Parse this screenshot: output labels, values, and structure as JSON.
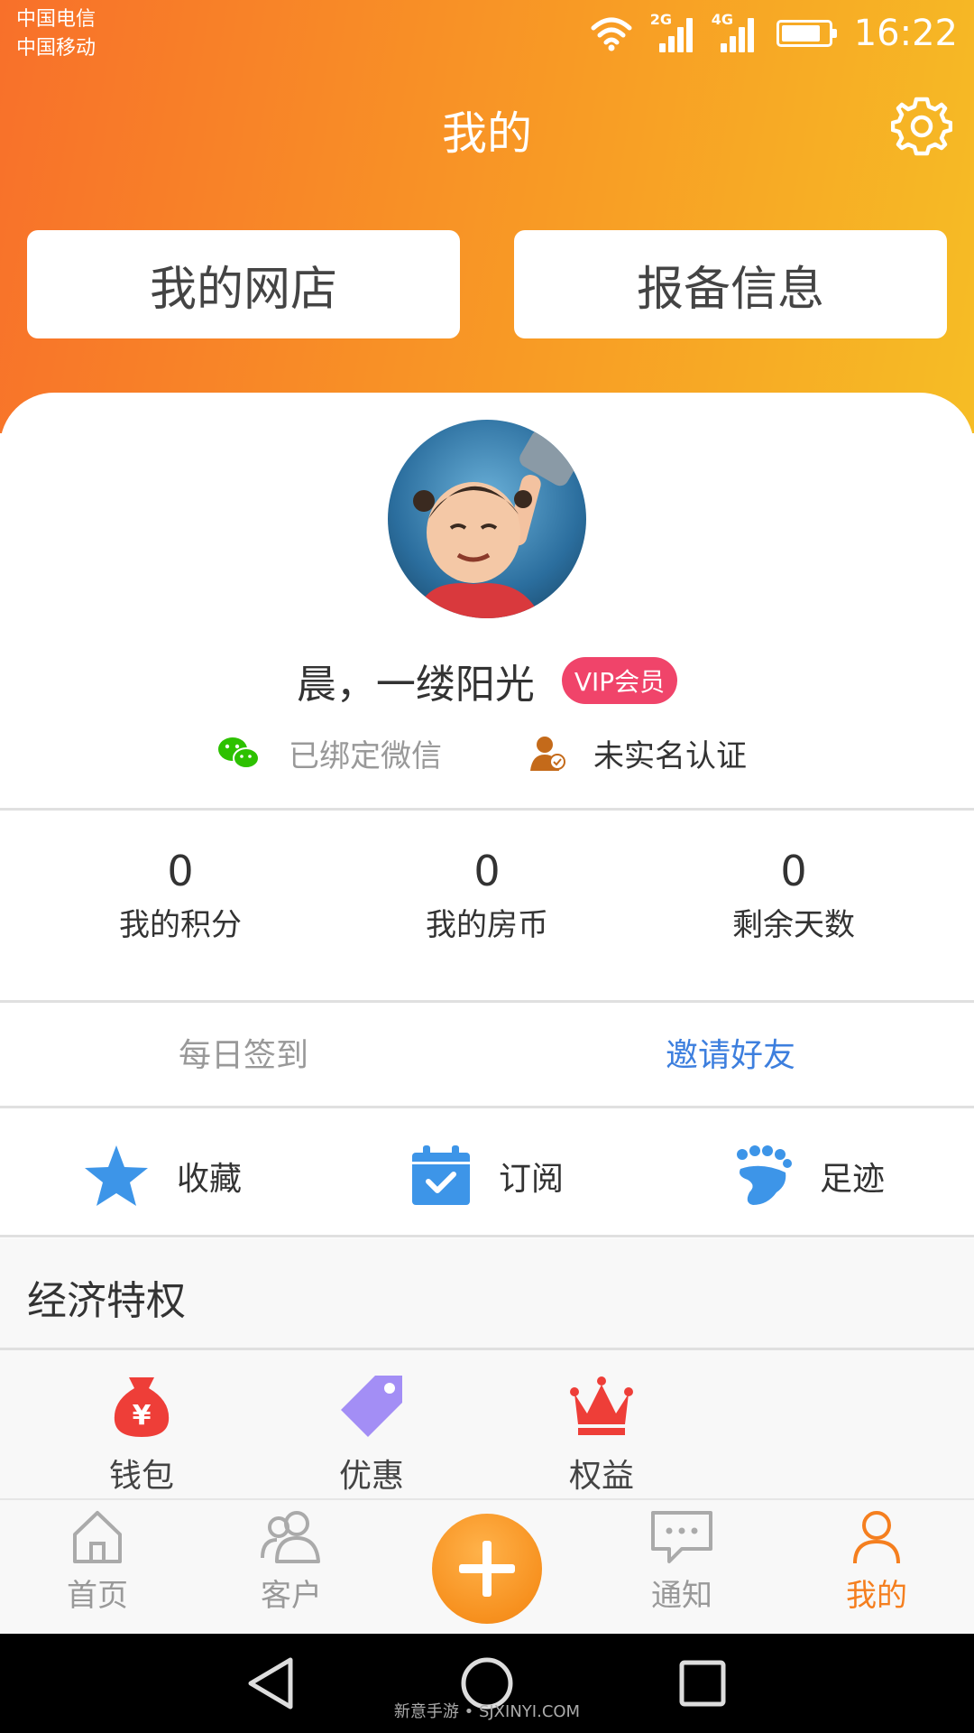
{
  "status_bar": {
    "carrier_1": "中国电信",
    "carrier_2": "中国移动",
    "signal_1_tag": "2G",
    "signal_2_tag": "4G",
    "time": "16:22"
  },
  "header": {
    "title": "我的",
    "settings_icon": "gear-icon",
    "buttons": [
      "我的网店",
      "报备信息"
    ]
  },
  "profile": {
    "username": "晨，一缕阳光",
    "vip_badge": "VIP会员",
    "wechat_status": "已绑定微信",
    "realname_status": "未实名认证"
  },
  "stats": [
    {
      "value": "0",
      "label": "我的积分"
    },
    {
      "value": "0",
      "label": "我的房币"
    },
    {
      "value": "0",
      "label": "剩余天数"
    }
  ],
  "actions": {
    "sign_in": "每日签到",
    "invite": "邀请好友"
  },
  "quick_links": [
    {
      "label": "收藏",
      "icon": "star-icon"
    },
    {
      "label": "订阅",
      "icon": "calendar-check-icon"
    },
    {
      "label": "足迹",
      "icon": "footprint-icon"
    }
  ],
  "privileges": {
    "title": "经济特权",
    "items": [
      {
        "label": "钱包",
        "icon": "money-bag-icon"
      },
      {
        "label": "优惠",
        "icon": "tag-icon"
      },
      {
        "label": "权益",
        "icon": "crown-icon"
      }
    ]
  },
  "tabbar": {
    "tabs": [
      {
        "label": "首页",
        "icon": "home-icon"
      },
      {
        "label": "客户",
        "icon": "users-icon"
      },
      {
        "label": "通知",
        "icon": "chat-icon"
      },
      {
        "label": "我的",
        "icon": "person-icon"
      }
    ],
    "active": "我的",
    "fab_icon": "plus-icon"
  },
  "watermark": "新意手游 • SJXINYI.COM",
  "colors": {
    "header_start": "#f8702a",
    "header_end": "#f6bd25",
    "accent": "#f57f1f",
    "vip": "#f0446a",
    "link": "#3d7fde"
  }
}
